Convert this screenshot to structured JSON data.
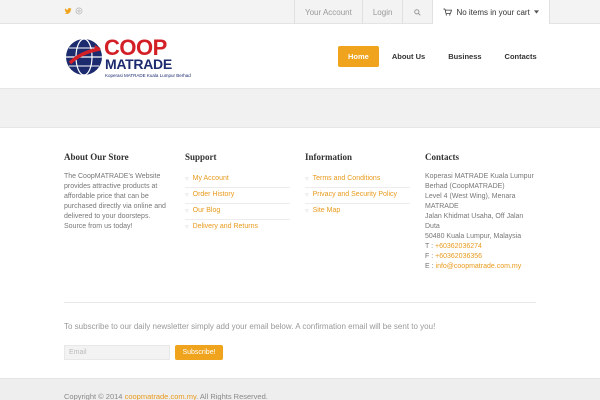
{
  "topbar": {
    "social": [
      {
        "icon": "twitter-icon"
      },
      {
        "icon": "email-icon"
      }
    ],
    "your_account": "Your Account",
    "login": "Login",
    "cart_label": "No items in your cart"
  },
  "header": {
    "logo_main": "COOP",
    "logo_sub": "MATRADE",
    "logo_tagline": "Koperasi MATRADE Kuala Lumpur Berhad",
    "nav": [
      {
        "label": "Home",
        "active": true
      },
      {
        "label": "About Us",
        "active": false
      },
      {
        "label": "Business",
        "active": false
      },
      {
        "label": "Contacts",
        "active": false
      }
    ]
  },
  "footer_cols": {
    "about": {
      "title": "About Our Store",
      "text": "The CoopMATRADE's Website provides attractive products at affordable price that can be purchased directly via online and delivered to your doorsteps. Source from us today!"
    },
    "support": {
      "title": "Support",
      "links": [
        "My Account",
        "Order History",
        "Our Blog",
        "Delivery and Returns"
      ]
    },
    "information": {
      "title": "Information",
      "links": [
        "Terms and Conditions",
        "Privacy and Security Policy",
        "Site Map"
      ]
    },
    "contacts": {
      "title": "Contacts",
      "address_1": "Koperasi MATRADE Kuala Lumpur Berhad (CoopMATRADE)",
      "address_2": "Level 4 (West Wing), Menara MATRADE",
      "address_3": "Jalan Khidmat Usaha, Off Jalan Duta",
      "address_4": "50480 Kuala Lumpur, Malaysia",
      "phone_label": "T :",
      "phone": "+60362036274",
      "fax_label": "F :",
      "fax": "+60362036356",
      "email_label": "E :",
      "email": "info@coopmatrade.com.my"
    }
  },
  "newsletter": {
    "text": "To subscribe to our daily newsletter simply add your email below. A confirmation email will be sent to you!",
    "placeholder": "Email",
    "button": "Subscribe!"
  },
  "copyright": {
    "prefix": "Copyright © 2014",
    "link": "coopmatrade.com.my",
    "suffix": ". All Rights Reserved."
  },
  "colors": {
    "accent": "#f0a31c",
    "logo_red": "#d31f26",
    "logo_blue": "#1c2a6e"
  }
}
